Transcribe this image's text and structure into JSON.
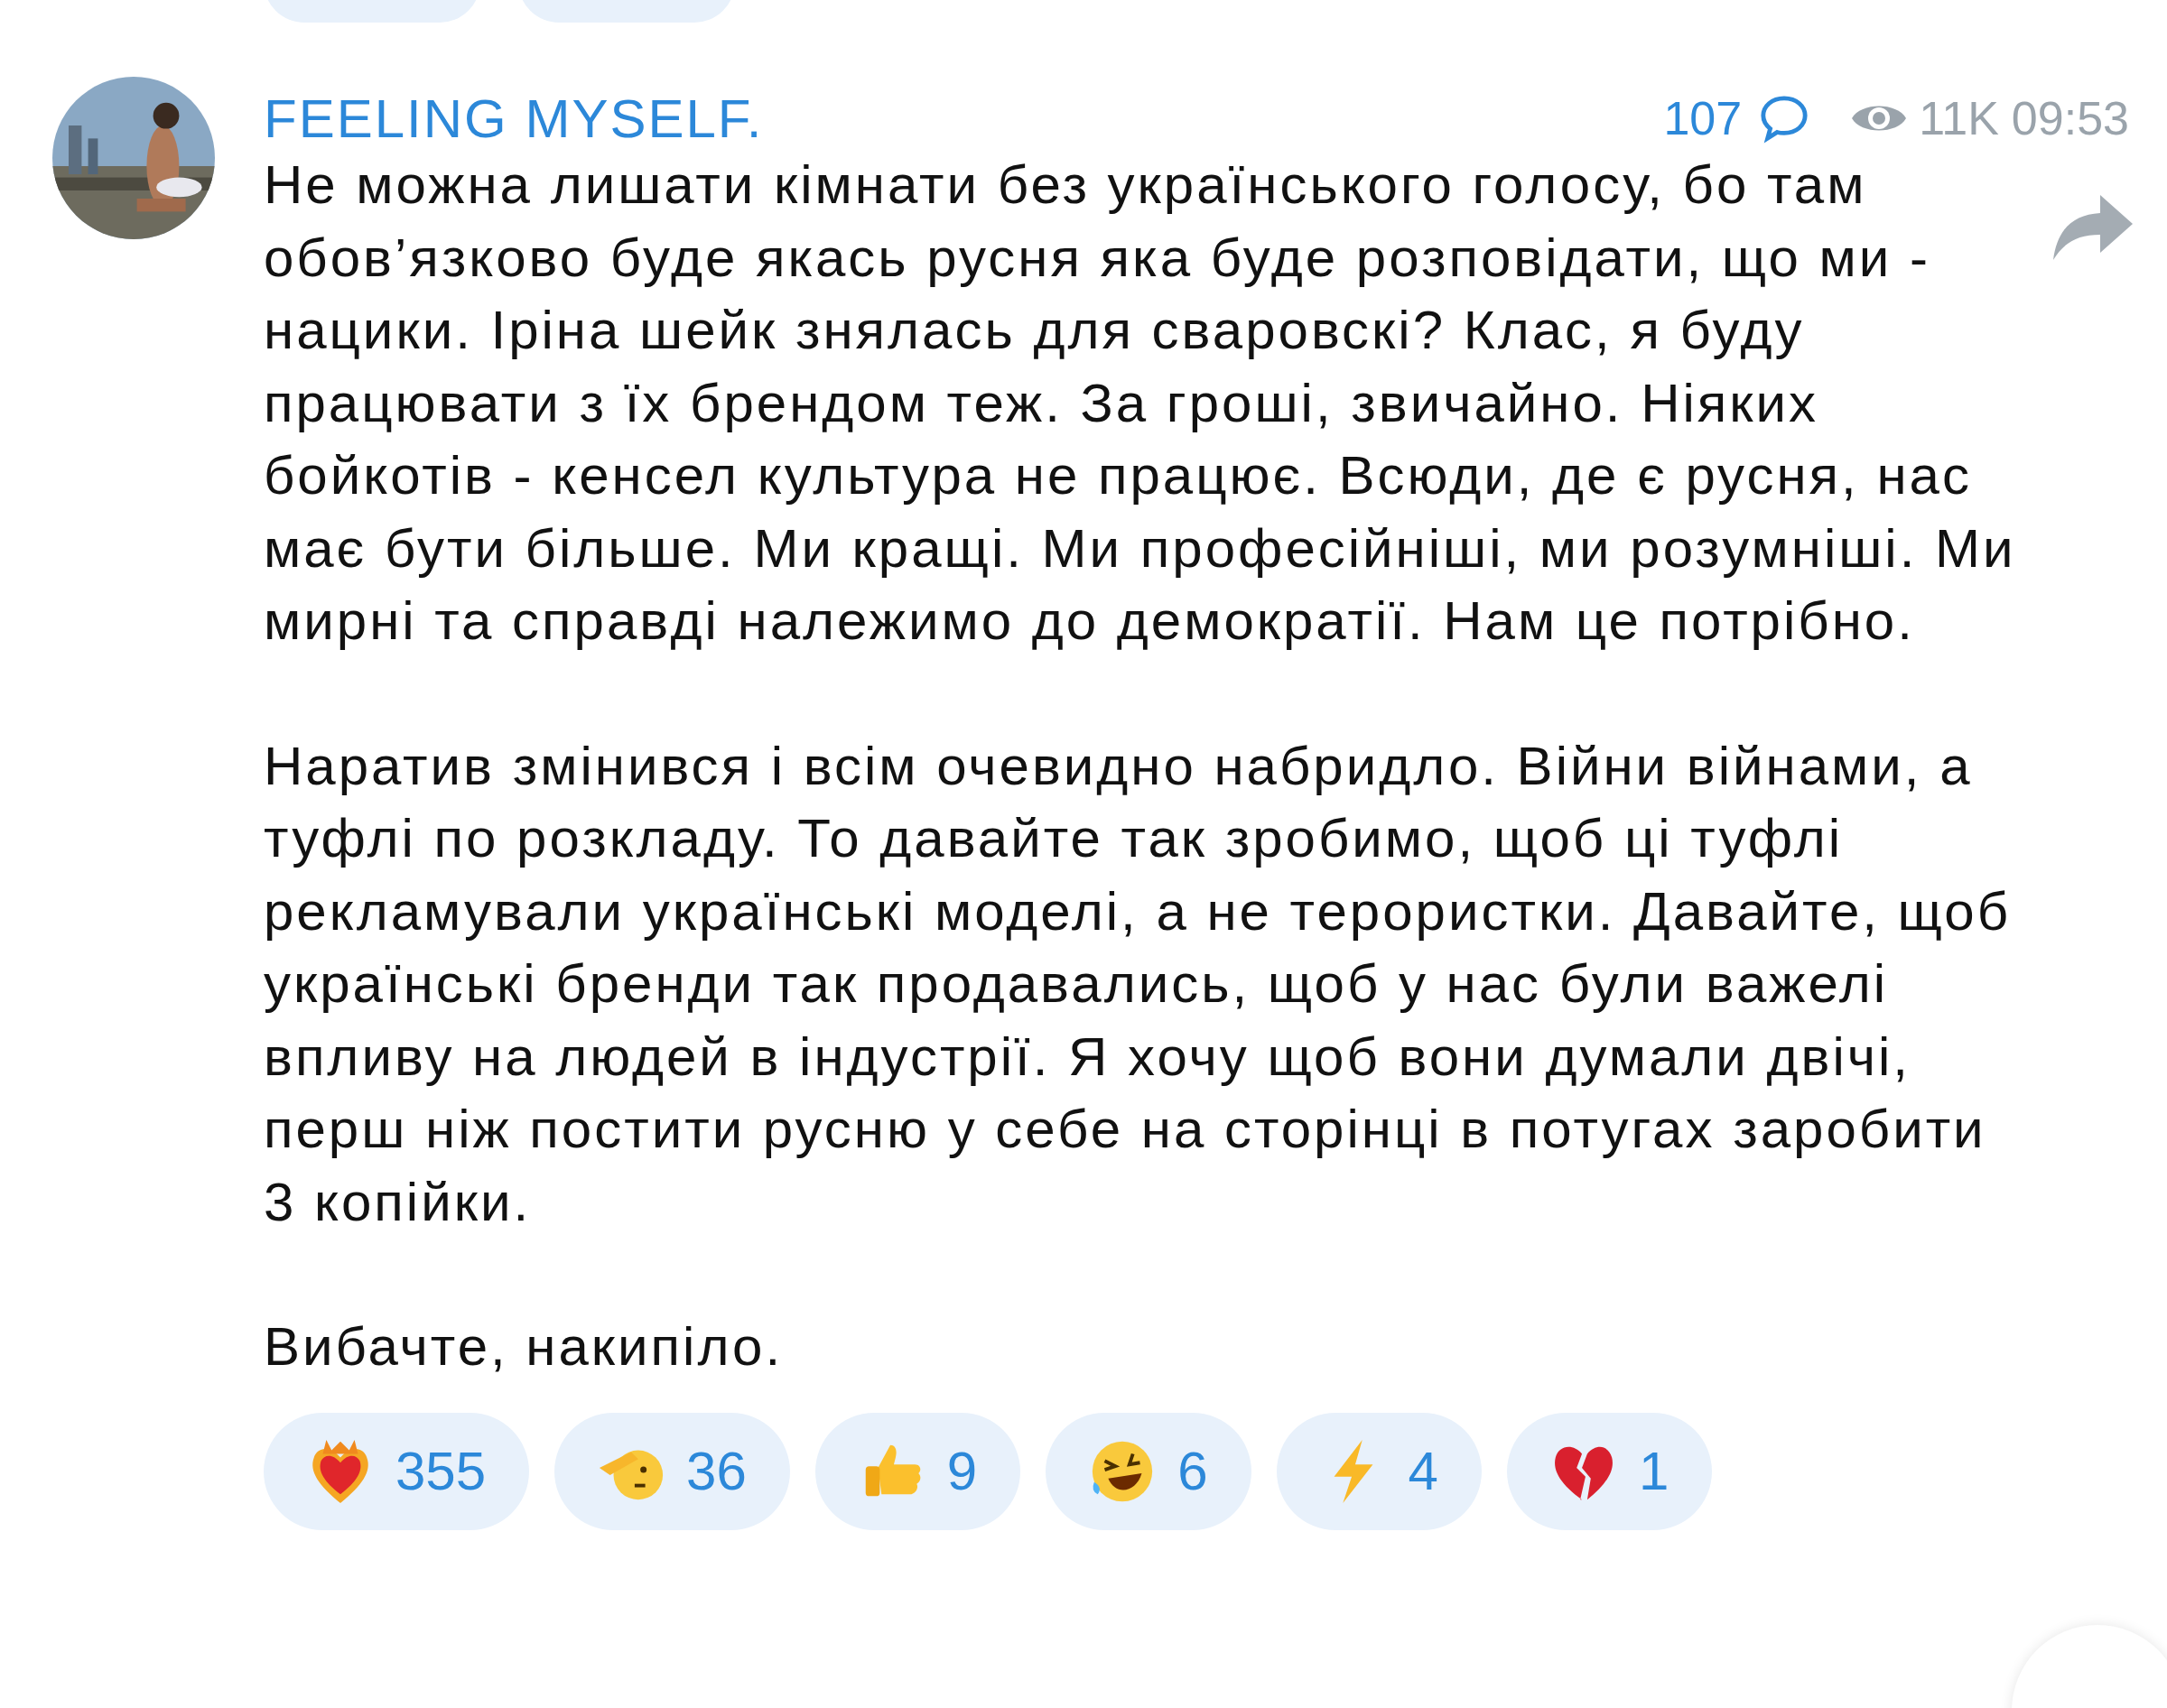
{
  "previous_message_reactions": [
    {
      "kind": "pill"
    },
    {
      "kind": "pill"
    }
  ],
  "message": {
    "author": "FEELING MYSELF.",
    "comments": "107",
    "views": "11K",
    "time": "09:53",
    "paragraphs": [
      "Не можна лишати кімнати без українського голосу, бо там обов’язково буде якась русня яка буде розповідати, що ми - нацики. Іріна шейк знялась для сваровскі? Клас, я буду працювати з їх брендом теж. За гроші, звичайно. Ніяких бойкотів - кенсел культура не працює. Всюди, де є русня, нас має бути більше. Ми кращі. Ми професійніші, ми розумніші. Ми мирні та справді належимо до демократії. Нам це потрібно.",
      "Наратив змінився і всім очевидно набридло. Війни війнами, а туфлі по розкладу. То давайте так зробимо, щоб ці туфлі рекламували українські моделі, а не терористки. Давайте, щоб українські бренди так продавались, щоб у нас були важелі впливу на людей в індустрії. Я хочу щоб вони думали двічі, перш ніж постити русню у себе на сторінці в потугах заробити 3 копійки.",
      "Вибачте, накипіло."
    ],
    "reactions": [
      {
        "kind": "heart_fire",
        "count": "355"
      },
      {
        "kind": "salute",
        "count": "36"
      },
      {
        "kind": "thumbs_up",
        "count": "9"
      },
      {
        "kind": "rofl",
        "count": "6"
      },
      {
        "kind": "lightning",
        "count": "4"
      },
      {
        "kind": "broken_heart",
        "count": "1"
      }
    ]
  }
}
